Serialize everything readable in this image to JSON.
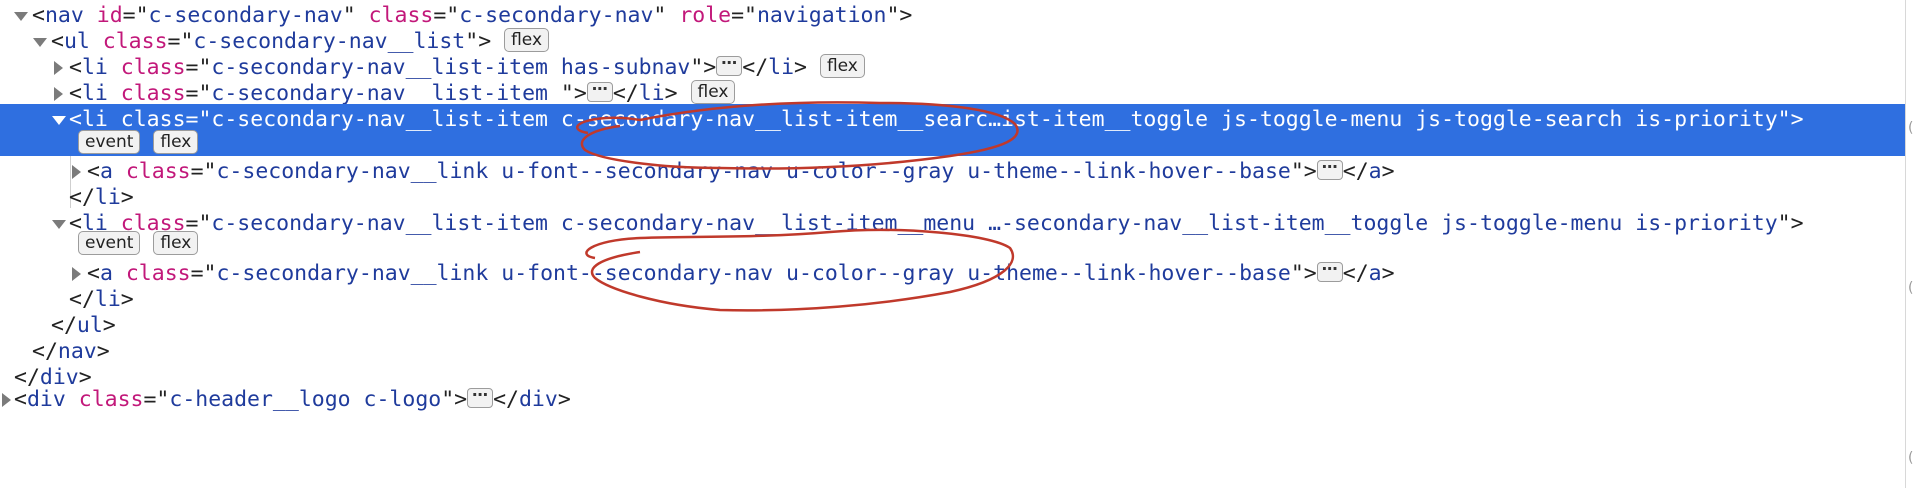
{
  "dom_tree": {
    "rows": [
      {
        "id": "r0",
        "parts": [
          "<",
          "nav",
          " ",
          "id",
          "=\"",
          "c-secondary-nav",
          "\"",
          " ",
          "class",
          "=\"",
          "c-secondary-nav",
          "\"",
          " ",
          "role",
          "=\"",
          "navigation",
          "\">"
        ]
      },
      {
        "id": "r1",
        "text_open": "<",
        "tag": "ul",
        "attr": "class",
        "value": "c-secondary-nav__list",
        "close": ">",
        "badges": [
          "flex"
        ]
      },
      {
        "id": "r2",
        "text_open": "<",
        "tag": "li",
        "attr": "class",
        "value": "c-secondary-nav__list-item has-subnav",
        "close": ">",
        "ellipsis": "⋯",
        "close_tag": "</li>",
        "badges": [
          "flex"
        ]
      },
      {
        "id": "r3",
        "text_open": "<",
        "tag": "li",
        "attr": "class",
        "value": "c-secondary-nav__list-item ",
        "close": ">",
        "ellipsis": "⋯",
        "close_tag": "</li>",
        "badges": [
          "flex"
        ]
      },
      {
        "id": "r4",
        "text_open": "<",
        "tag": "li",
        "attr": "class",
        "value": "c-secondary-nav__list-item c-secondary-nav__list-item__searc…ist-item__toggle js-toggle-menu js-toggle-search is-priority",
        "close": ">",
        "badges": [
          "event",
          "flex"
        ]
      },
      {
        "id": "r5",
        "text_open": "<",
        "tag": "a",
        "attr": "class",
        "value": "c-secondary-nav__link u-font--secondary-nav u-color--gray u-theme--link-hover--base",
        "close": ">",
        "ellipsis": "⋯",
        "close_tag": "</a>"
      },
      {
        "id": "r6",
        "close_tag": "</li>"
      },
      {
        "id": "r7",
        "text_open": "<",
        "tag": "li",
        "attr": "class",
        "value": "c-secondary-nav__list-item c-secondary-nav__list-item__menu …-secondary-nav__list-item__toggle js-toggle-menu is-priority",
        "close": ">",
        "badges": [
          "event",
          "flex"
        ]
      },
      {
        "id": "r8",
        "text_open": "<",
        "tag": "a",
        "attr": "class",
        "value": "c-secondary-nav__link u-font--secondary-nav u-color--gray u-theme--link-hover--base",
        "close": ">",
        "ellipsis": "⋯",
        "close_tag": "</a>"
      },
      {
        "id": "r9",
        "close_tag": "</li>"
      },
      {
        "id": "r10",
        "close_tag": "</ul>"
      },
      {
        "id": "r11",
        "close_tag": "</nav>"
      },
      {
        "id": "r12",
        "close_tag": "</div>"
      },
      {
        "id": "r13",
        "text_open": "<",
        "tag": "div",
        "attr": "class",
        "value": "c-header__logo c-logo",
        "close": ">",
        "ellipsis": "⋯",
        "close_tag": "</div>"
      }
    ]
  },
  "labels": {
    "nav_open": "<nav id=\"c-secondary-nav\" class=\"c-secondary-nav\" role=\"navigation\">",
    "ul_class": "c-secondary-nav__list",
    "li1_class": "c-secondary-nav__list-item has-subnav",
    "li2_class": "c-secondary-nav__list-item ",
    "li3_class": "c-secondary-nav__list-item c-secondary-nav__list-item__searc…ist-item__toggle js-toggle-menu js-toggle-search is-priority",
    "a_class": "c-secondary-nav__link u-font--secondary-nav u-color--gray u-theme--link-hover--base",
    "li4_class": "c-secondary-nav__list-item c-secondary-nav__list-item__menu …-secondary-nav__list-item__toggle js-toggle-menu is-priority",
    "logo_class": "c-header__logo c-logo",
    "badge_flex": "flex",
    "badge_event": "event",
    "ellipsis": "⋯",
    "tag_nav": "nav",
    "tag_ul": "ul",
    "tag_li": "li",
    "tag_a": "a",
    "tag_div": "div",
    "attr_id": "id",
    "attr_class": "class",
    "attr_role": "role",
    "val_nav_id": "c-secondary-nav",
    "val_nav_class": "c-secondary-nav",
    "val_role": "navigation",
    "close_li": "</li>",
    "close_a": "</a>",
    "close_ul": "</ul>",
    "close_nav": "</nav>",
    "close_div": "</div>"
  },
  "colors": {
    "selection": "#2f6fe0",
    "tag": "#1f3b9c",
    "attribute": "#c2187a",
    "annotation": "#c0392b"
  },
  "icons": {
    "expanded": "triangle-down-icon",
    "collapsed": "triangle-right-icon"
  }
}
